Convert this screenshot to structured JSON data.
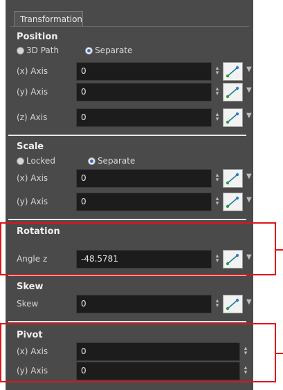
{
  "tab": {
    "label": "Transformation"
  },
  "position": {
    "title": "Position",
    "radio_3d_path": "3D Path",
    "radio_separate": "Separate",
    "rows": [
      {
        "label": "(x) Axis",
        "value": "0"
      },
      {
        "label": "(y) Axis",
        "value": "0"
      },
      {
        "label": "(z) Axis",
        "value": "0"
      }
    ]
  },
  "scale": {
    "title": "Scale",
    "radio_locked": "Locked",
    "radio_separate": "Separate",
    "rows": [
      {
        "label": "(x) Axis",
        "value": "0"
      },
      {
        "label": "(y) Axis",
        "value": "0"
      }
    ]
  },
  "rotation": {
    "title": "Rotation",
    "rows": [
      {
        "label": "Angle z",
        "value": "-48.5781"
      }
    ]
  },
  "skew": {
    "title": "Skew",
    "rows": [
      {
        "label": "Skew",
        "value": "0"
      }
    ]
  },
  "pivot": {
    "title": "Pivot",
    "rows": [
      {
        "label": "(x) Axis",
        "value": "0"
      },
      {
        "label": "(y) Axis",
        "value": "0"
      }
    ]
  },
  "colors": {
    "highlight": "#e0141a",
    "panel": "#4a4a4a",
    "field": "#1c1c1c"
  },
  "icons": {
    "function_button": "function-curve-icon",
    "spinner": "spinner-arrows-icon",
    "dropdown": "chevron-down-icon"
  }
}
